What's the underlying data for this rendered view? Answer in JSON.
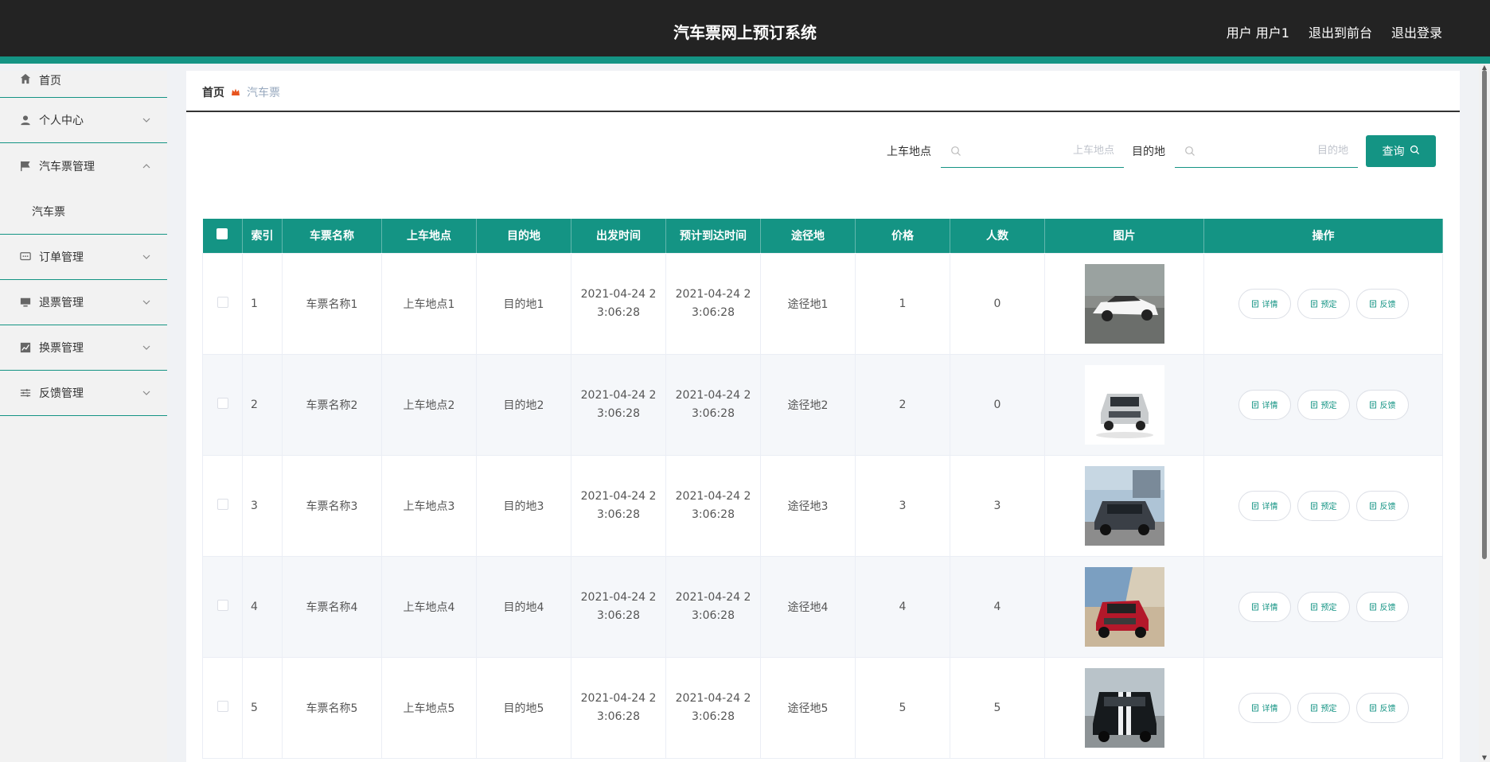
{
  "header": {
    "title": "汽车票网上预订系统",
    "user_label": "用户 用户1",
    "front_label": "退出到前台",
    "logout_label": "退出登录"
  },
  "sidebar": {
    "items": [
      {
        "label": "首页",
        "icon": "home-icon"
      },
      {
        "label": "个人中心",
        "icon": "user-icon"
      },
      {
        "label": "汽车票管理",
        "icon": "flag-icon"
      },
      {
        "label": "汽车票"
      },
      {
        "label": "订单管理",
        "icon": "chat-icon"
      },
      {
        "label": "退票管理",
        "icon": "monitor-icon"
      },
      {
        "label": "换票管理",
        "icon": "chart-icon"
      },
      {
        "label": "反馈管理",
        "icon": "sliders-icon"
      }
    ]
  },
  "breadcrumb": {
    "home": "首页",
    "current": "汽车票"
  },
  "search": {
    "board_label": "上车地点",
    "board_placeholder": "上车地点",
    "dest_label": "目的地",
    "dest_placeholder": "目的地",
    "query_label": "查询"
  },
  "table": {
    "headers": [
      "索引",
      "车票名称",
      "上车地点",
      "目的地",
      "出发时间",
      "预计到达时间",
      "途径地",
      "价格",
      "人数",
      "图片",
      "操作"
    ],
    "rows": [
      {
        "index": "1",
        "name": "车票名称1",
        "board": "上车地点1",
        "dest": "目的地1",
        "depart_a": "2021-04-24 2",
        "depart_b": "3:06:28",
        "arrive_a": "2021-04-24 2",
        "arrive_b": "3:06:28",
        "via": "途径地1",
        "price": "1",
        "people": "0"
      },
      {
        "index": "2",
        "name": "车票名称2",
        "board": "上车地点2",
        "dest": "目的地2",
        "depart_a": "2021-04-24 2",
        "depart_b": "3:06:28",
        "arrive_a": "2021-04-24 2",
        "arrive_b": "3:06:28",
        "via": "途径地2",
        "price": "2",
        "people": "0"
      },
      {
        "index": "3",
        "name": "车票名称3",
        "board": "上车地点3",
        "dest": "目的地3",
        "depart_a": "2021-04-24 2",
        "depart_b": "3:06:28",
        "arrive_a": "2021-04-24 2",
        "arrive_b": "3:06:28",
        "via": "途径地3",
        "price": "3",
        "people": "3"
      },
      {
        "index": "4",
        "name": "车票名称4",
        "board": "上车地点4",
        "dest": "目的地4",
        "depart_a": "2021-04-24 2",
        "depart_b": "3:06:28",
        "arrive_a": "2021-04-24 2",
        "arrive_b": "3:06:28",
        "via": "途径地4",
        "price": "4",
        "people": "4"
      },
      {
        "index": "5",
        "name": "车票名称5",
        "board": "上车地点5",
        "dest": "目的地5",
        "depart_a": "2021-04-24 2",
        "depart_b": "3:06:28",
        "arrive_a": "2021-04-24 2",
        "arrive_b": "3:06:28",
        "via": "途径地5",
        "price": "5",
        "people": "5"
      }
    ],
    "actions": {
      "detail": "详情",
      "book": "预定",
      "feedback": "反馈"
    }
  },
  "colors": {
    "accent": "#149484",
    "header_bg": "#232323",
    "breadcrumb_sep": "#e7541e"
  }
}
